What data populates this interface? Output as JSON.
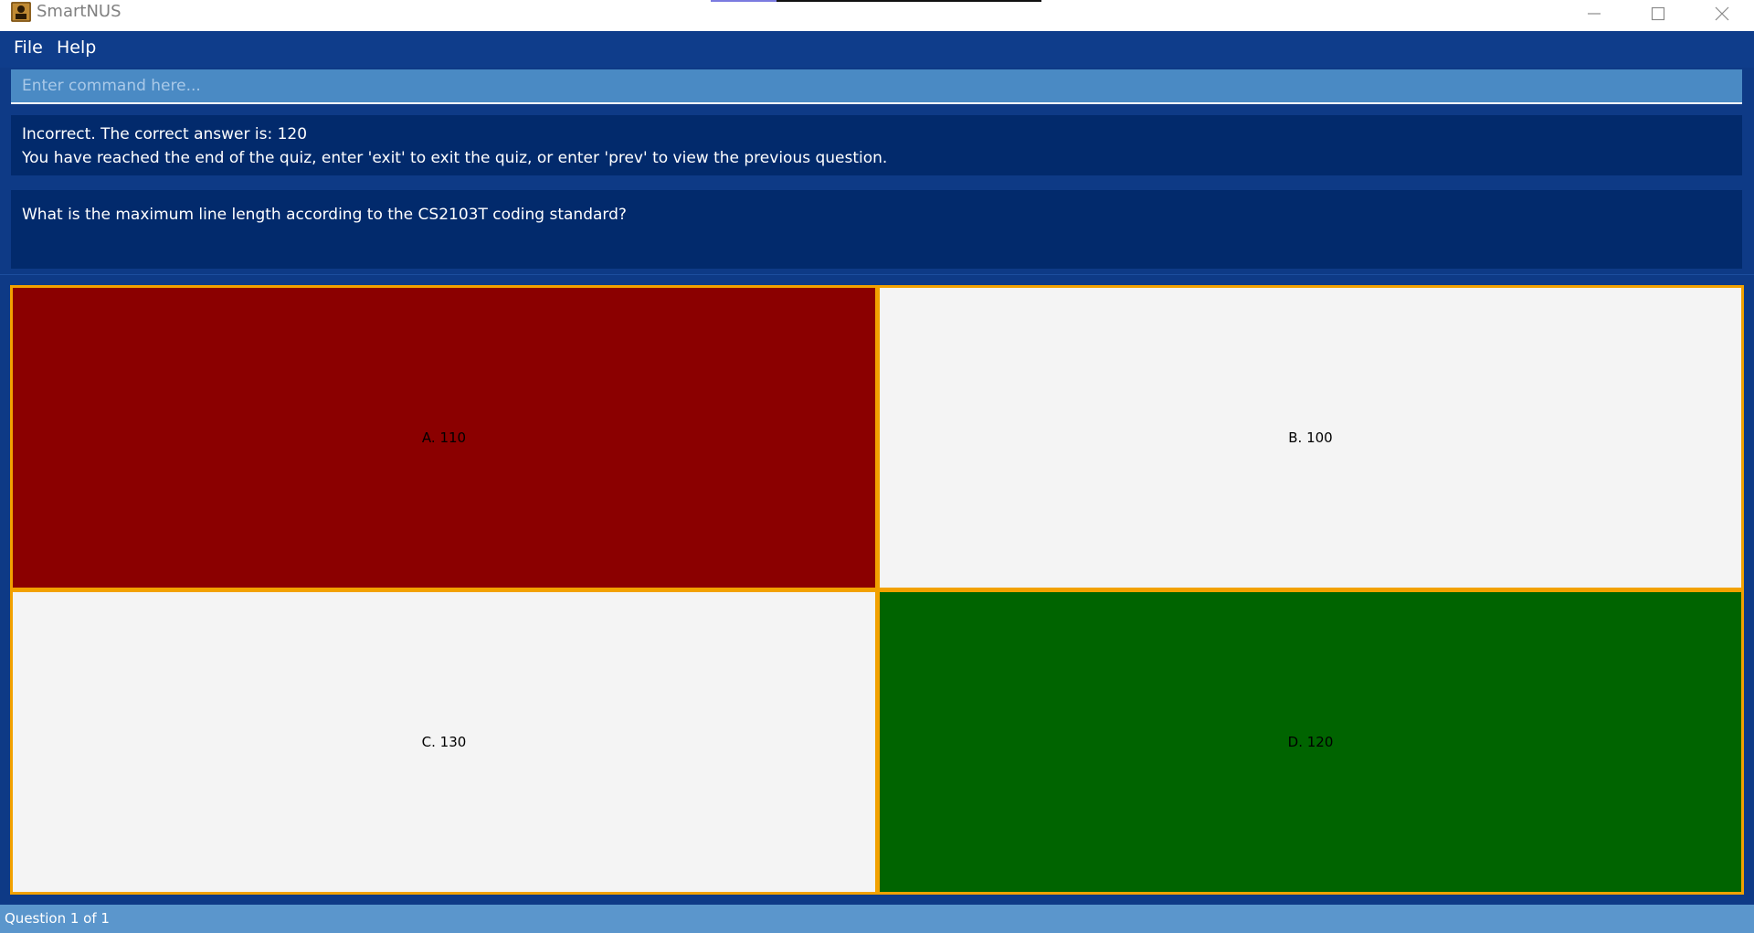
{
  "window": {
    "title": "SmartNUS",
    "icon": "app-icon"
  },
  "menu": {
    "items": [
      {
        "label": "File"
      },
      {
        "label": "Help"
      }
    ]
  },
  "command": {
    "placeholder": "Enter command here...",
    "value": ""
  },
  "result": {
    "lines": [
      "Incorrect. The correct answer is: 120",
      "You have reached the end of the quiz, enter 'exit' to exit the quiz, or enter 'prev' to view the previous question."
    ]
  },
  "question": {
    "text": "What is the maximum line length according to the CS2103T coding standard?"
  },
  "options": [
    {
      "label": "A. 110",
      "state": "wrong",
      "color": "#8b0000"
    },
    {
      "label": "B. 100",
      "state": "neutral",
      "color": "#f4f4f4"
    },
    {
      "label": "C. 130",
      "state": "neutral",
      "color": "#f4f4f4"
    },
    {
      "label": "D. 120",
      "state": "correct",
      "color": "#006400"
    }
  ],
  "status": {
    "text": "Question 1 of 1"
  },
  "colors": {
    "background": "#0e3a86",
    "panel": "#022a6c",
    "command_field": "#4a8ac4",
    "option_border": "#f2a100",
    "status_bar": "#5b96cc"
  }
}
